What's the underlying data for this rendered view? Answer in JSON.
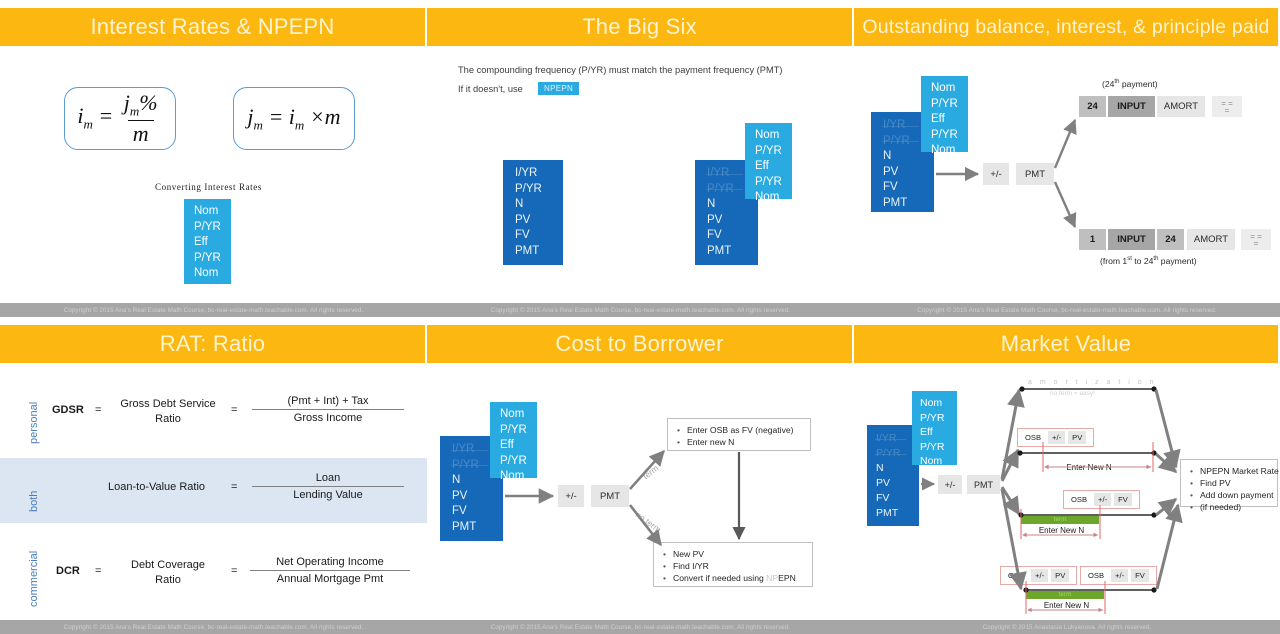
{
  "footer_default": "Copyright © 2015 Ana's Real Estate Math Course, bc-real-estate-math.teachable.com. All rights reserved.",
  "footer_last": "Copyright © 2015 Anastasia Lukyanova. All rights reserved.",
  "colors": {
    "title_bar": "#FCB711",
    "title_text": "#FFF3D0",
    "big_six_box": "#1569B8",
    "npepn_box": "#29ABE2",
    "band": "#DCE6F2",
    "side_label": "#4A7EBB",
    "red_box_border": "#E8A9A9",
    "term_green": "#6CA72C",
    "footer_bar": "#A6A6A6",
    "arrow_gray": "#808080"
  },
  "slide1": {
    "title": "Interest Rates & NPEPN",
    "formula_left": {
      "lhs": "i",
      "lhs_sub": "m",
      "eq": "=",
      "num": "j",
      "num_sub": "m",
      "num_pct": "%",
      "den": "m"
    },
    "formula_right": {
      "lhs": "j",
      "lhs_sub": "m",
      "eq": "=",
      "rhs": "i",
      "rhs_sub": "m",
      "times": "×",
      "rhs2": "m"
    },
    "converting_label": "Converting Interest Rates",
    "npepn_rows": [
      "Nom",
      "P/YR",
      "Eff",
      "P/YR",
      "Nom"
    ]
  },
  "slide2": {
    "title": "The Big Six",
    "line1": "The compounding frequency (P/YR) must match the payment frequency (PMT)",
    "line2_prefix": "If it doesn't, use",
    "chip": "NPEPN",
    "stack_left": [
      "I/YR",
      "P/YR",
      "N",
      "PV",
      "FV",
      "PMT"
    ],
    "stack_right_faded": [
      "I/YR",
      "P/YR"
    ],
    "stack_right_active": [
      "N",
      "PV",
      "FV",
      "PMT"
    ],
    "npepn_rows": [
      "Nom",
      "P/YR",
      "Eff",
      "P/YR",
      "Nom"
    ]
  },
  "slide3": {
    "title": "Outstanding balance, interest, & principle paid",
    "stack_faded": [
      "I/YR",
      "P/YR"
    ],
    "stack_active": [
      "N",
      "PV",
      "FV",
      "PMT"
    ],
    "npepn_rows": [
      "Nom",
      "P/YR",
      "Eff",
      "P/YR",
      "Nom"
    ],
    "key_plusminus": "+/-",
    "key_pmt": "PMT",
    "top_note": "(24th payment)",
    "top_note_pre": "(24",
    "top_note_sup": "th",
    "top_note_post": " payment)",
    "top_keys": [
      "24",
      "INPUT",
      "AMORT"
    ],
    "eq_key_top": "= =\n=",
    "bottom_keys": [
      "1",
      "INPUT",
      "24",
      "AMORT"
    ],
    "bottom_note_pre": "(from 1",
    "bottom_note_sup1": "st",
    "bottom_note_mid": " to 24",
    "bottom_note_sup2": "th",
    "bottom_note_post": " payment)"
  },
  "slide4": {
    "title": "RAT: Ratio",
    "rows": [
      {
        "side": "personal",
        "abbr": "GDSR",
        "eq1": "=",
        "name_line1": "Gross Debt Service",
        "name_line2": "Ratio",
        "eq2": "=",
        "num": "(Pmt + Int) + Tax",
        "den": "Gross Income"
      },
      {
        "side": "both",
        "abbr": "",
        "eq1": "",
        "name_line1": "Loan-to-Value Ratio",
        "name_line2": "",
        "eq2": "=",
        "num": "Loan",
        "den": "Lending Value"
      },
      {
        "side": "commercial",
        "abbr": "DCR",
        "eq1": "=",
        "name_line1": "Debt Coverage",
        "name_line2": "Ratio",
        "eq2": "=",
        "num": "Net Operating Income",
        "den": "Annual Mortgage Pmt"
      }
    ]
  },
  "slide5": {
    "title": "Cost to Borrower",
    "stack_faded": [
      "I/YR",
      "P/YR"
    ],
    "stack_active": [
      "N",
      "PV",
      "FV",
      "PMT"
    ],
    "npepn_rows": [
      "Nom",
      "P/YR",
      "Eff",
      "P/YR",
      "Nom"
    ],
    "key_plusminus": "+/-",
    "key_pmt": "PMT",
    "arm_top_label": "term",
    "arm_bottom_label": "no term",
    "box_top": [
      "Enter OSB as FV (negative)",
      "Enter new N"
    ],
    "box_bottom": [
      "New PV",
      "Find I/YR",
      "Convert if needed using "
    ],
    "box_bottom_last_dim": "NP",
    "box_bottom_last_rest": "EPN"
  },
  "slide6": {
    "title": "Market Value",
    "stack_faded": [
      "I/YR",
      "P/YR"
    ],
    "stack_active": [
      "N",
      "PV",
      "FV",
      "PMT"
    ],
    "npepn_rows": [
      "Nom",
      "P/YR",
      "Eff",
      "P/YR",
      "Nom"
    ],
    "key_plusminus": "+/-",
    "key_pmt": "PMT",
    "amort_label": "a m o r t i z a t i o n",
    "easy_label": "no term = easy!",
    "row2_box": [
      "OSB",
      "+/-",
      "PV"
    ],
    "row2_enter": "Enter New N",
    "row3_box": [
      "OSB",
      "+/-",
      "FV"
    ],
    "row3_term": "term",
    "row3_enter": "Enter New N",
    "row4_box_a": [
      "OSB",
      "+/-",
      "PV"
    ],
    "row4_box_b": [
      "OSB",
      "+/-",
      "FV"
    ],
    "row4_term": "term",
    "row4_enter": "Enter New N",
    "result_bullets": [
      "NPEPN Market Rate",
      "Find PV",
      "Add down payment",
      "(if needed)"
    ]
  }
}
